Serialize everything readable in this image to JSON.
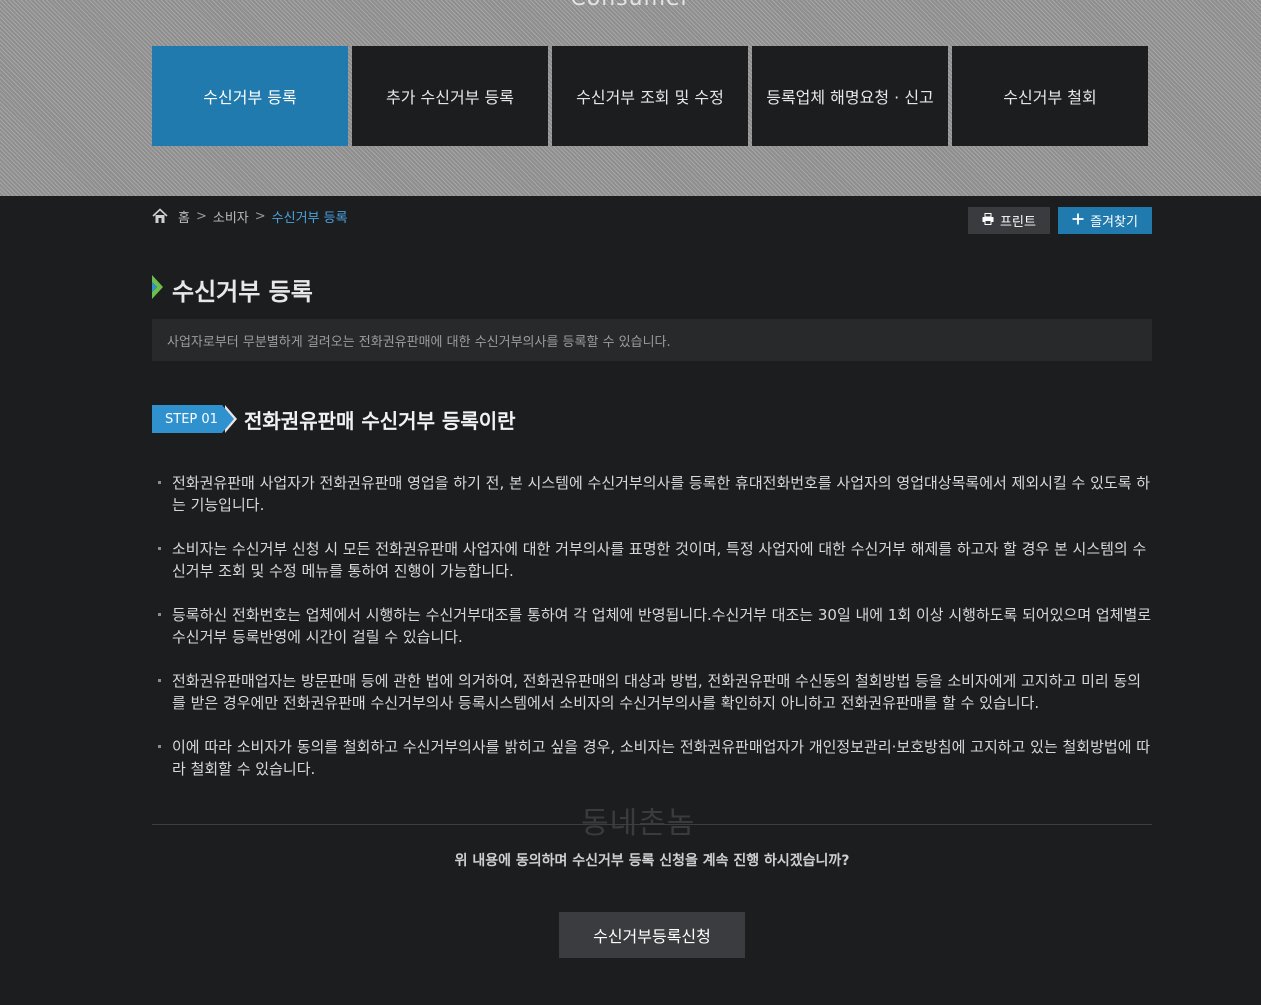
{
  "hero": {
    "title": "Consumer"
  },
  "tabs": [
    {
      "label": "수신거부 등록",
      "active": true
    },
    {
      "label": "추가 수신거부 등록",
      "active": false
    },
    {
      "label": "수신거부 조회 및 수정",
      "active": false
    },
    {
      "label": "등록업체 해명요청 · 신고",
      "active": false
    },
    {
      "label": "수신거부 철회",
      "active": false
    }
  ],
  "breadcrumb": {
    "home": "홈",
    "section": "소비자",
    "current": "수신거부 등록",
    "separator": ">"
  },
  "toolbar": {
    "print_label": "프린트",
    "favorite_label": "즐겨찾기"
  },
  "page": {
    "title": "수신거부 등록",
    "description": "사업자로부터 무분별하게 걸려오는 전화권유판매에 대한 수신거부의사를 등록할 수 있습니다."
  },
  "step": {
    "badge": "STEP 01",
    "title": "전화권유판매 수신거부 등록이란"
  },
  "bullets": [
    "전화권유판매 사업자가 전화권유판매 영업을 하기 전, 본 시스템에 수신거부의사를 등록한 휴대전화번호를 사업자의 영업대상목록에서 제외시킬 수 있도록 하는 기능입니다.",
    "소비자는 수신거부 신청 시 모든 전화권유판매 사업자에 대한 거부의사를 표명한 것이며, 특정 사업자에 대한 수신거부 해제를 하고자 할 경우 본 시스템의 수신거부 조회 및 수정 메뉴를 통하여 진행이 가능합니다.",
    "등록하신 전화번호는 업체에서 시행하는 수신거부대조를 통하여 각 업체에 반영됩니다.수신거부 대조는 30일 내에 1회 이상 시행하도록 되어있으며 업체별로 수신거부 등록반영에 시간이 걸릴 수 있습니다.",
    "전화권유판매업자는 방문판매 등에 관한 법에 의거하여, 전화권유판매의 대상과 방법, 전화권유판매 수신동의 철회방법 등을 소비자에게 고지하고 미리 동의를 받은 경우에만 전화권유판매 수신거부의사 등록시스템에서 소비자의 수신거부의사를 확인하지 아니하고 전화권유판매를 할 수 있습니다.",
    "이에 따라 소비자가 동의를 철회하고 수신거부의사를 밝히고 싶을 경우, 소비자는 전화권유판매업자가 개인정보관리·보호방침에 고지하고 있는 철회방법에 따라 철회할 수 있습니다."
  ],
  "watermark": "동네촌놈",
  "confirm": {
    "question": "위 내용에 동의하며 수신거부 등록 신청을 계속 진행 하시겠습니까?",
    "button_label": "수신거부등록신청"
  },
  "colors": {
    "accent": "#207aae",
    "step": "#2f92cf",
    "breadcrumb_current": "#4aa3df",
    "background": "#1c1d1f"
  }
}
